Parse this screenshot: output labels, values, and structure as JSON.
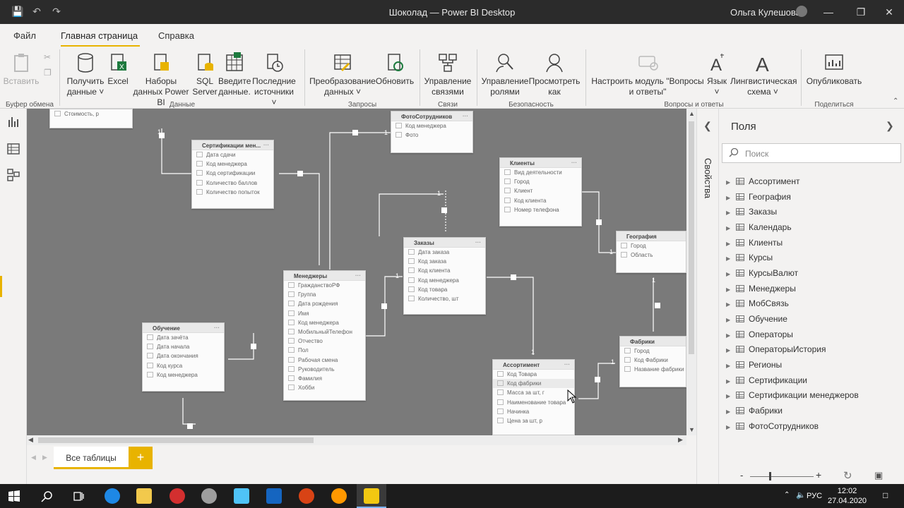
{
  "window": {
    "title": "Шоколад — Power BI Desktop",
    "user": "Ольга Кулешова"
  },
  "menu": {
    "tabs": [
      "Файл",
      "Главная страница",
      "Справка"
    ]
  },
  "ribbon": {
    "paste": "Вставить",
    "get_data": "Получить данные",
    "excel": "Excel",
    "powerbi_datasets": "Наборы данных Power BI",
    "sql_server": "SQL Server",
    "enter_data": "Введите данные.",
    "recent_sources": "Последние источники",
    "transform": "Преобразование данных",
    "refresh": "Обновить",
    "manage_rel": "Управление связями",
    "manage_roles": "Управление ролями",
    "view_as": "Просмотреть как",
    "qa_setup": "Настроить модуль \"Вопросы и ответы\"",
    "language": "Язык",
    "linguistic": "Лингвистическая схема",
    "publish": "Опубликовать",
    "groups": {
      "clipboard": "Буфер обмена",
      "data": "Данные",
      "queries": "Запросы",
      "relationships": "Связи",
      "security": "Безопасность",
      "qa": "Вопросы и ответы",
      "share": "Поделиться"
    }
  },
  "model": {
    "tables": [
      {
        "name": "",
        "fields": [
          "Стоимость, р"
        ]
      },
      {
        "name": "ФотоСотрудников",
        "fields": [
          "Код менеджера",
          "Фото"
        ]
      },
      {
        "name": "Сертификации мен...",
        "fields": [
          "Дата сдачи",
          "Код менеджера",
          "Код сертификации",
          "Количество баллов",
          "Количество попыток"
        ]
      },
      {
        "name": "Клиенты",
        "fields": [
          "Вид деятельности",
          "Город",
          "Клиент",
          "Код клиента",
          "Номер телефона"
        ]
      },
      {
        "name": "География",
        "fields": [
          "Город",
          "Область"
        ]
      },
      {
        "name": "Заказы",
        "fields": [
          "Дата заказа",
          "Код заказа",
          "Код клиента",
          "Код менеджера",
          "Код товара",
          "Количество, шт"
        ]
      },
      {
        "name": "Менеджеры",
        "fields": [
          "ГражданствоРФ",
          "Группа",
          "Дата рождения",
          "Имя",
          "Код менеджера",
          "МобильныйТелефон",
          "Отчество",
          "Пол",
          "Рабочая смена",
          "Руководитель",
          "Фамилия",
          "Хобби"
        ]
      },
      {
        "name": "Обучение",
        "fields": [
          "Дата зачёта",
          "Дата начала",
          "Дата окончания",
          "Код курса",
          "Код менеджера"
        ]
      },
      {
        "name": "Ассортимент",
        "fields": [
          "Код Товара",
          "Код фабрики",
          "Масса за шт, г",
          "Наименование товара",
          "Начинка",
          "Цена за шт, р"
        ]
      },
      {
        "name": "Фабрики",
        "fields": [
          "Город",
          "Код Фабрики",
          "Название фабрики"
        ]
      }
    ],
    "cardinality_labels": [
      "1",
      "1",
      "1",
      "1",
      "1",
      "1",
      "1",
      "1"
    ]
  },
  "tabs": {
    "page": "Все таблицы",
    "add": "+"
  },
  "sidepanel": {
    "properties": "Свойства",
    "fields_title": "Поля",
    "search_placeholder": "Поиск",
    "field_tables": [
      "Ассортимент",
      "География",
      "Заказы",
      "Календарь",
      "Клиенты",
      "Курсы",
      "КурсыВалют",
      "Менеджеры",
      "МобСвязь",
      "Обучение",
      "Операторы",
      "ОператорыИстория",
      "Регионы",
      "Сертификации",
      "Сертификации менеджеров",
      "Фабрики",
      "ФотоСотрудников"
    ]
  },
  "zoom": {
    "minus": "-",
    "plus": "+"
  },
  "taskbar": {
    "lang": "РУС",
    "time": "12:02",
    "date": "27.04.2020"
  }
}
